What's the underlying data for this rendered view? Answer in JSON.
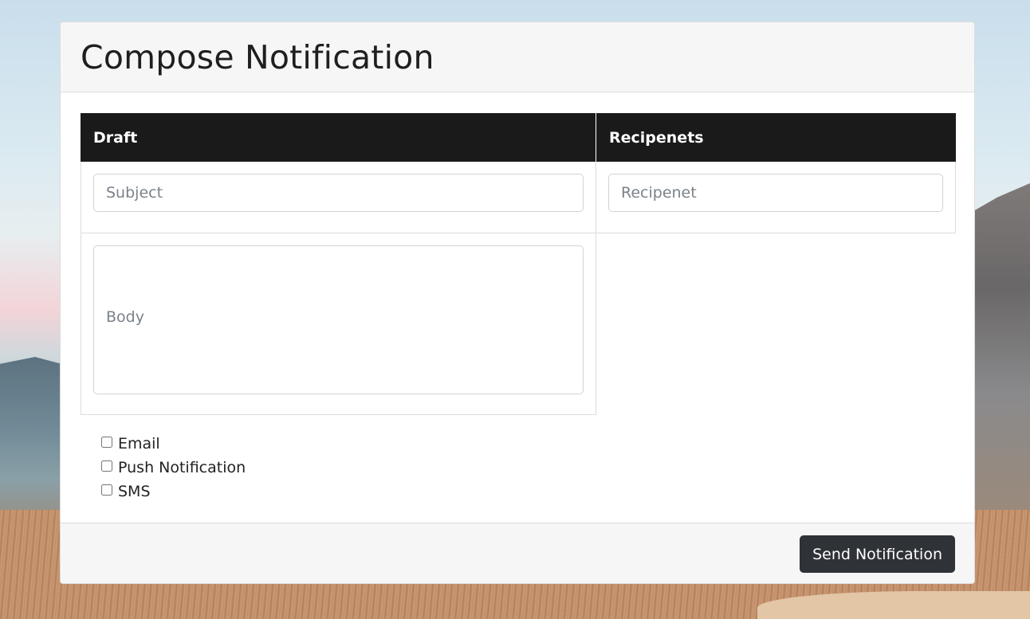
{
  "card": {
    "title": "Compose Notification"
  },
  "table": {
    "headers": {
      "draft": "Draft",
      "recipients": "Recipenets"
    },
    "subject_placeholder": "Subject",
    "recipient_placeholder": "Recipenet",
    "body_placeholder": "Body"
  },
  "channels": [
    {
      "label": "Email",
      "checked": false
    },
    {
      "label": "Push Notification",
      "checked": false
    },
    {
      "label": "SMS",
      "checked": false
    }
  ],
  "footer": {
    "send_label": "Send Notification"
  },
  "colors": {
    "header_bg": "#1a1a1a",
    "button_bg": "#2f3237",
    "card_header_bg": "#f6f6f6"
  }
}
